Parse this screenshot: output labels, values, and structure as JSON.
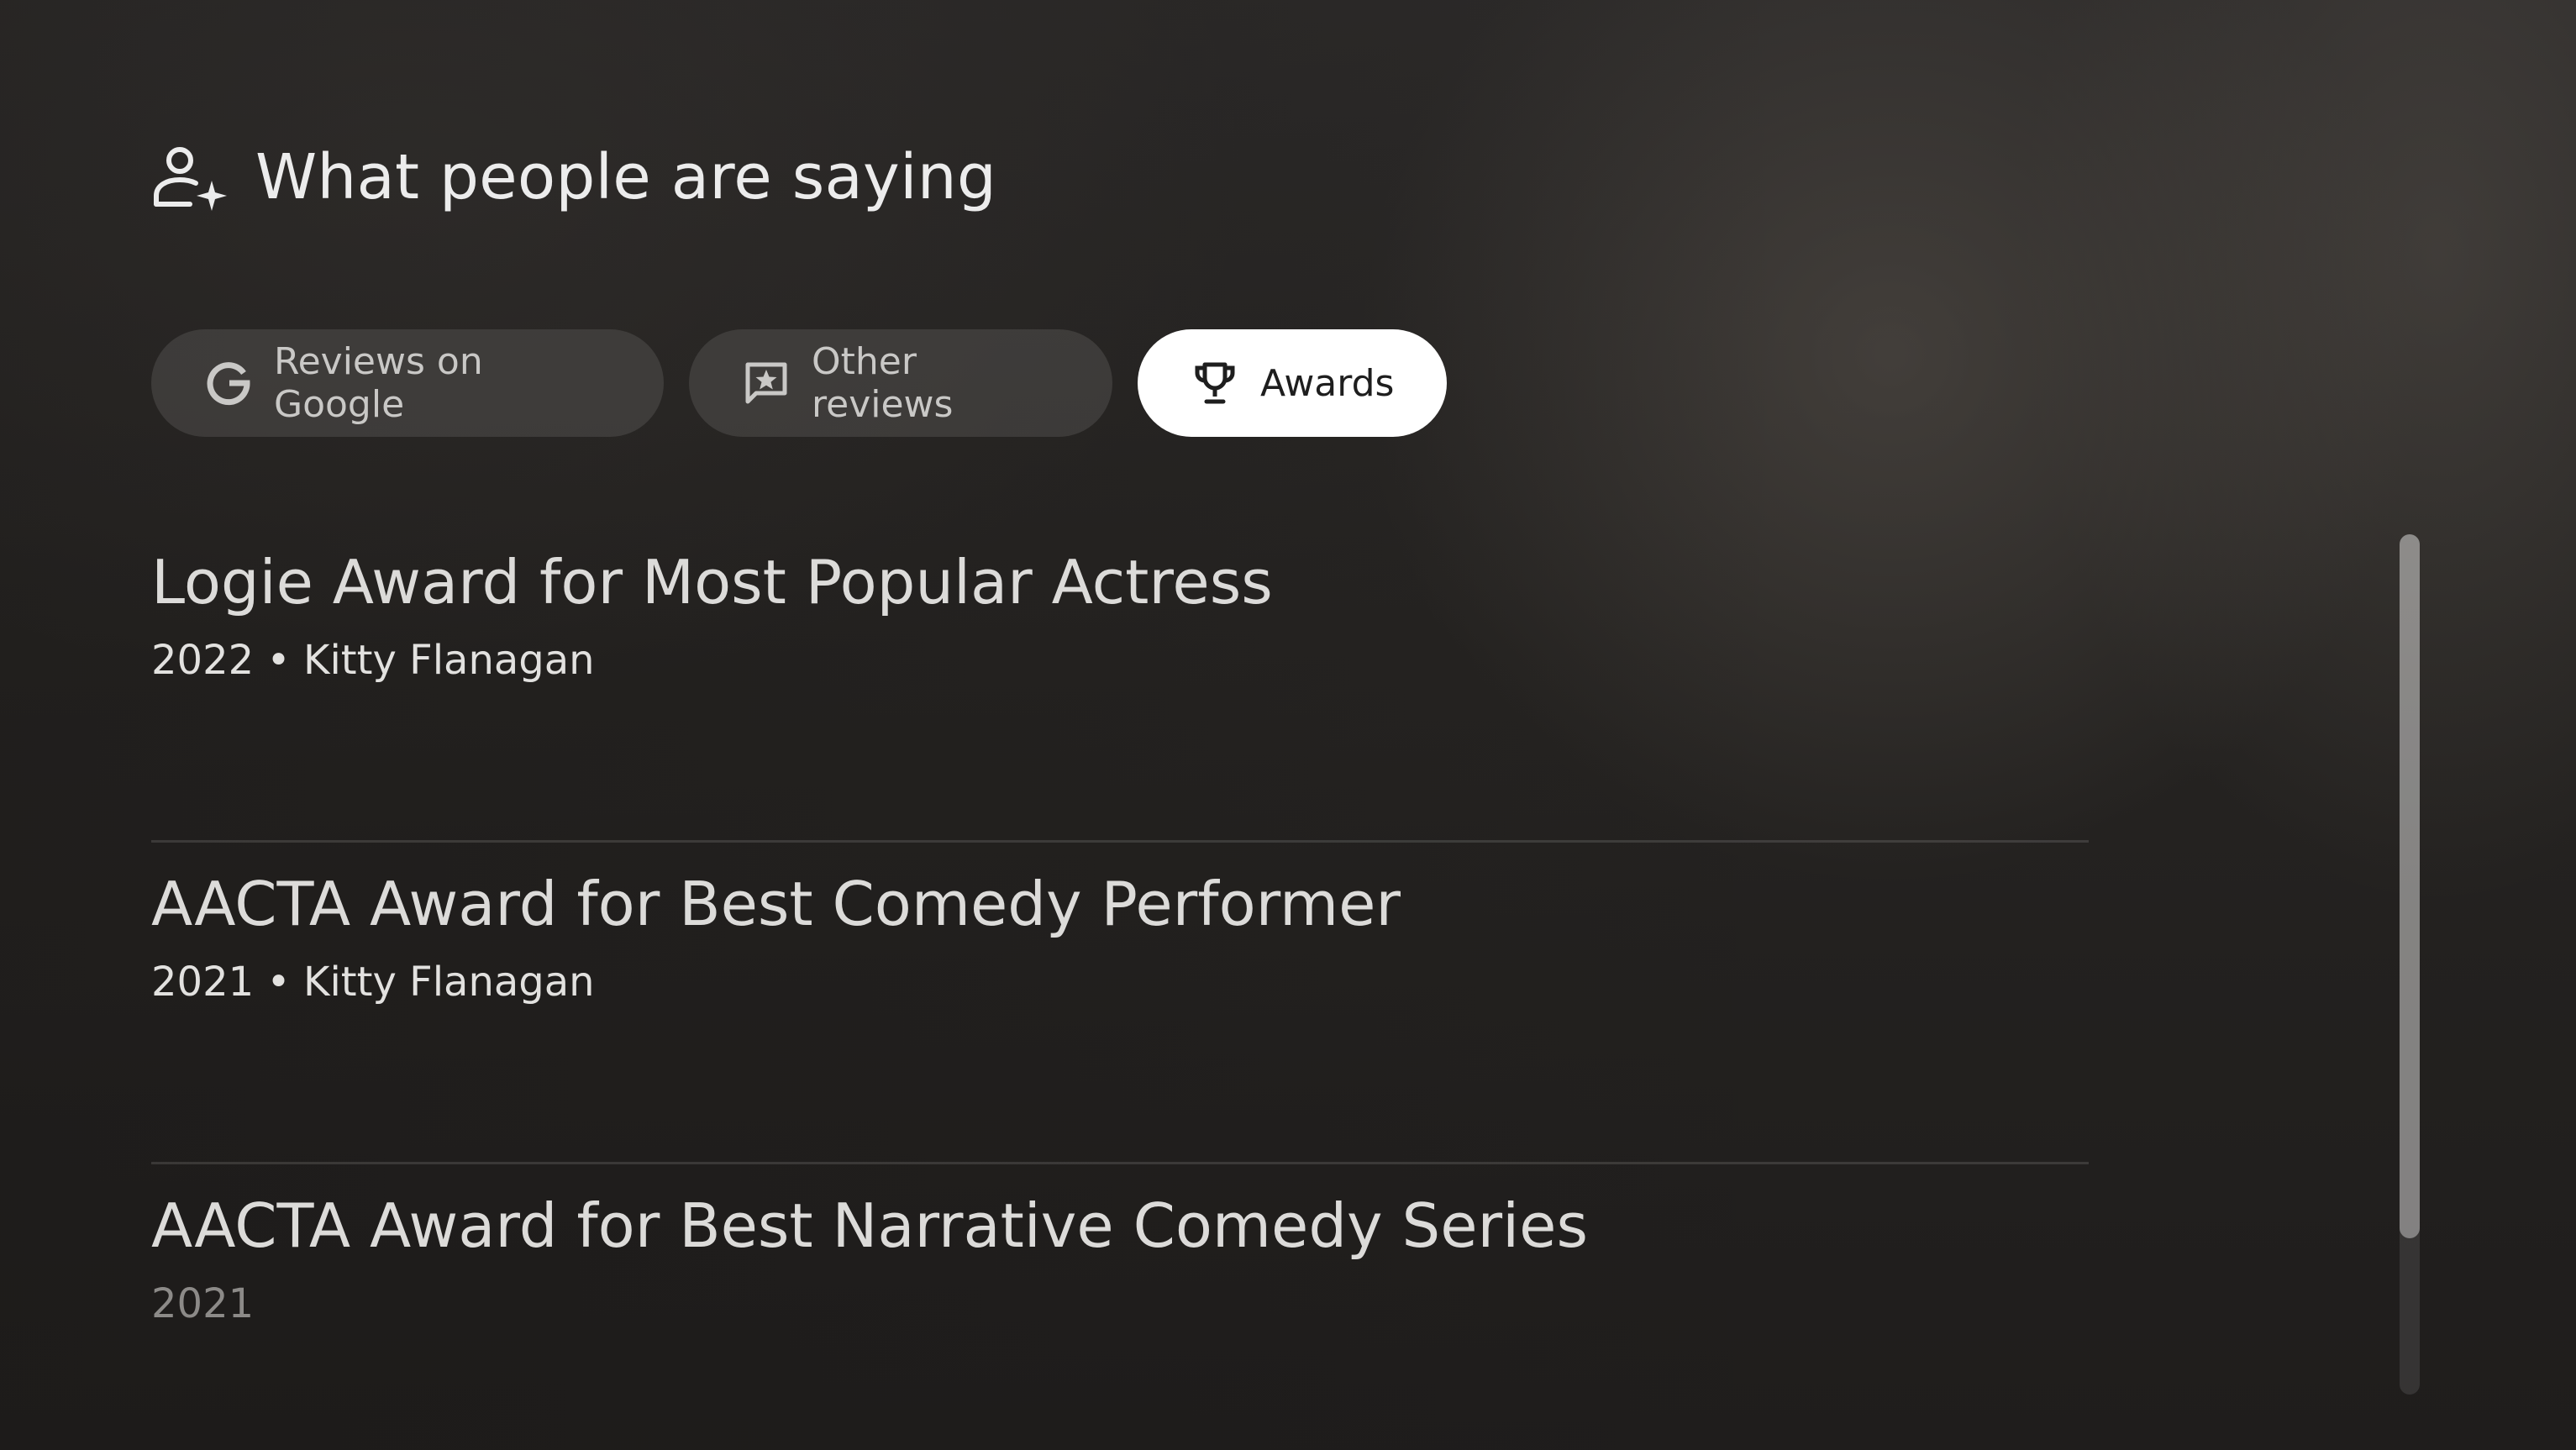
{
  "header": {
    "title": "What people are saying",
    "icon": "person-sparkle-icon"
  },
  "tabs": [
    {
      "label": "Reviews on Google",
      "icon": "google-g-icon",
      "selected": false
    },
    {
      "label": "Other reviews",
      "icon": "review-star-icon",
      "selected": false
    },
    {
      "label": "Awards",
      "icon": "trophy-icon",
      "selected": true
    }
  ],
  "awards": [
    {
      "title": "Logie Award for Most Popular Actress",
      "meta": "2022 • Kitty Flanagan"
    },
    {
      "title": "AACTA Award for Best Comedy Performer",
      "meta": "2021 • Kitty Flanagan"
    },
    {
      "title": "AACTA Award for Best Narrative Comedy Series",
      "meta": "2021"
    }
  ],
  "colors": {
    "background": "#1f1d1c",
    "chip_inactive": "#4d4b49",
    "chip_active": "#ffffff",
    "text_primary": "#ececec"
  }
}
